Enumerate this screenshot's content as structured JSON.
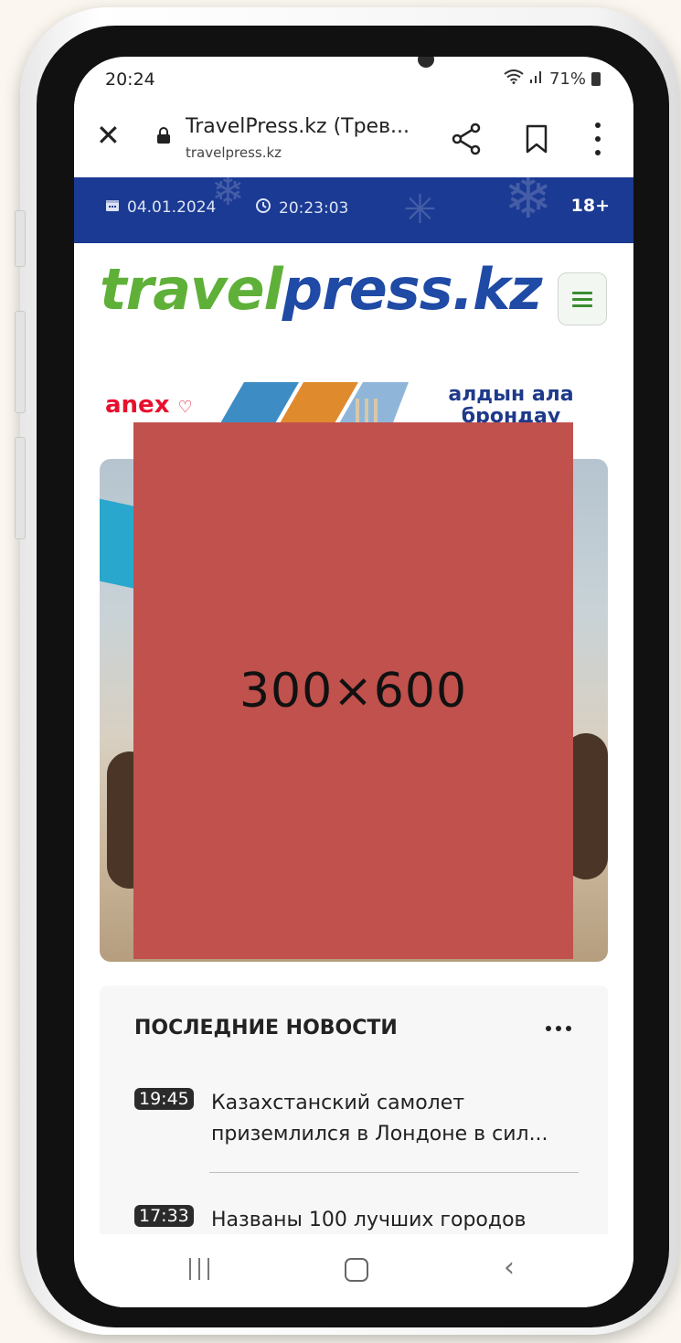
{
  "status": {
    "time": "20:24",
    "battery": "71%"
  },
  "browser": {
    "title": "TravelPress.kz (Трев...",
    "url": "travelpress.kz",
    "close_icon": "close-icon",
    "share_icon": "share-icon",
    "bookmark_icon": "bookmark-icon",
    "more_icon": "more-vert-icon"
  },
  "topbar": {
    "date": "04.01.2024",
    "time": "20:23:03",
    "age": "18+",
    "bg": "#1b3a93"
  },
  "logo": {
    "part1": "travel",
    "part2": "press.kz",
    "color1": "#5fb038",
    "color2": "#1f4aa5"
  },
  "ad_banner": {
    "brand": "anex",
    "text": "алдын ала брондау"
  },
  "ad_block": {
    "label": "300×600",
    "color": "#c0514d"
  },
  "news": {
    "heading": "ПОСЛЕДНИЕ НОВОСТИ",
    "items": [
      {
        "time": "19:45",
        "title": "Казахстанский самолет приземлился в Лондоне в сил..."
      },
      {
        "time": "17:33",
        "title": "Названы 100 лучших городов"
      }
    ]
  },
  "navbar": {
    "recent": "recent-apps-icon",
    "home": "home-icon",
    "back": "back-icon"
  }
}
